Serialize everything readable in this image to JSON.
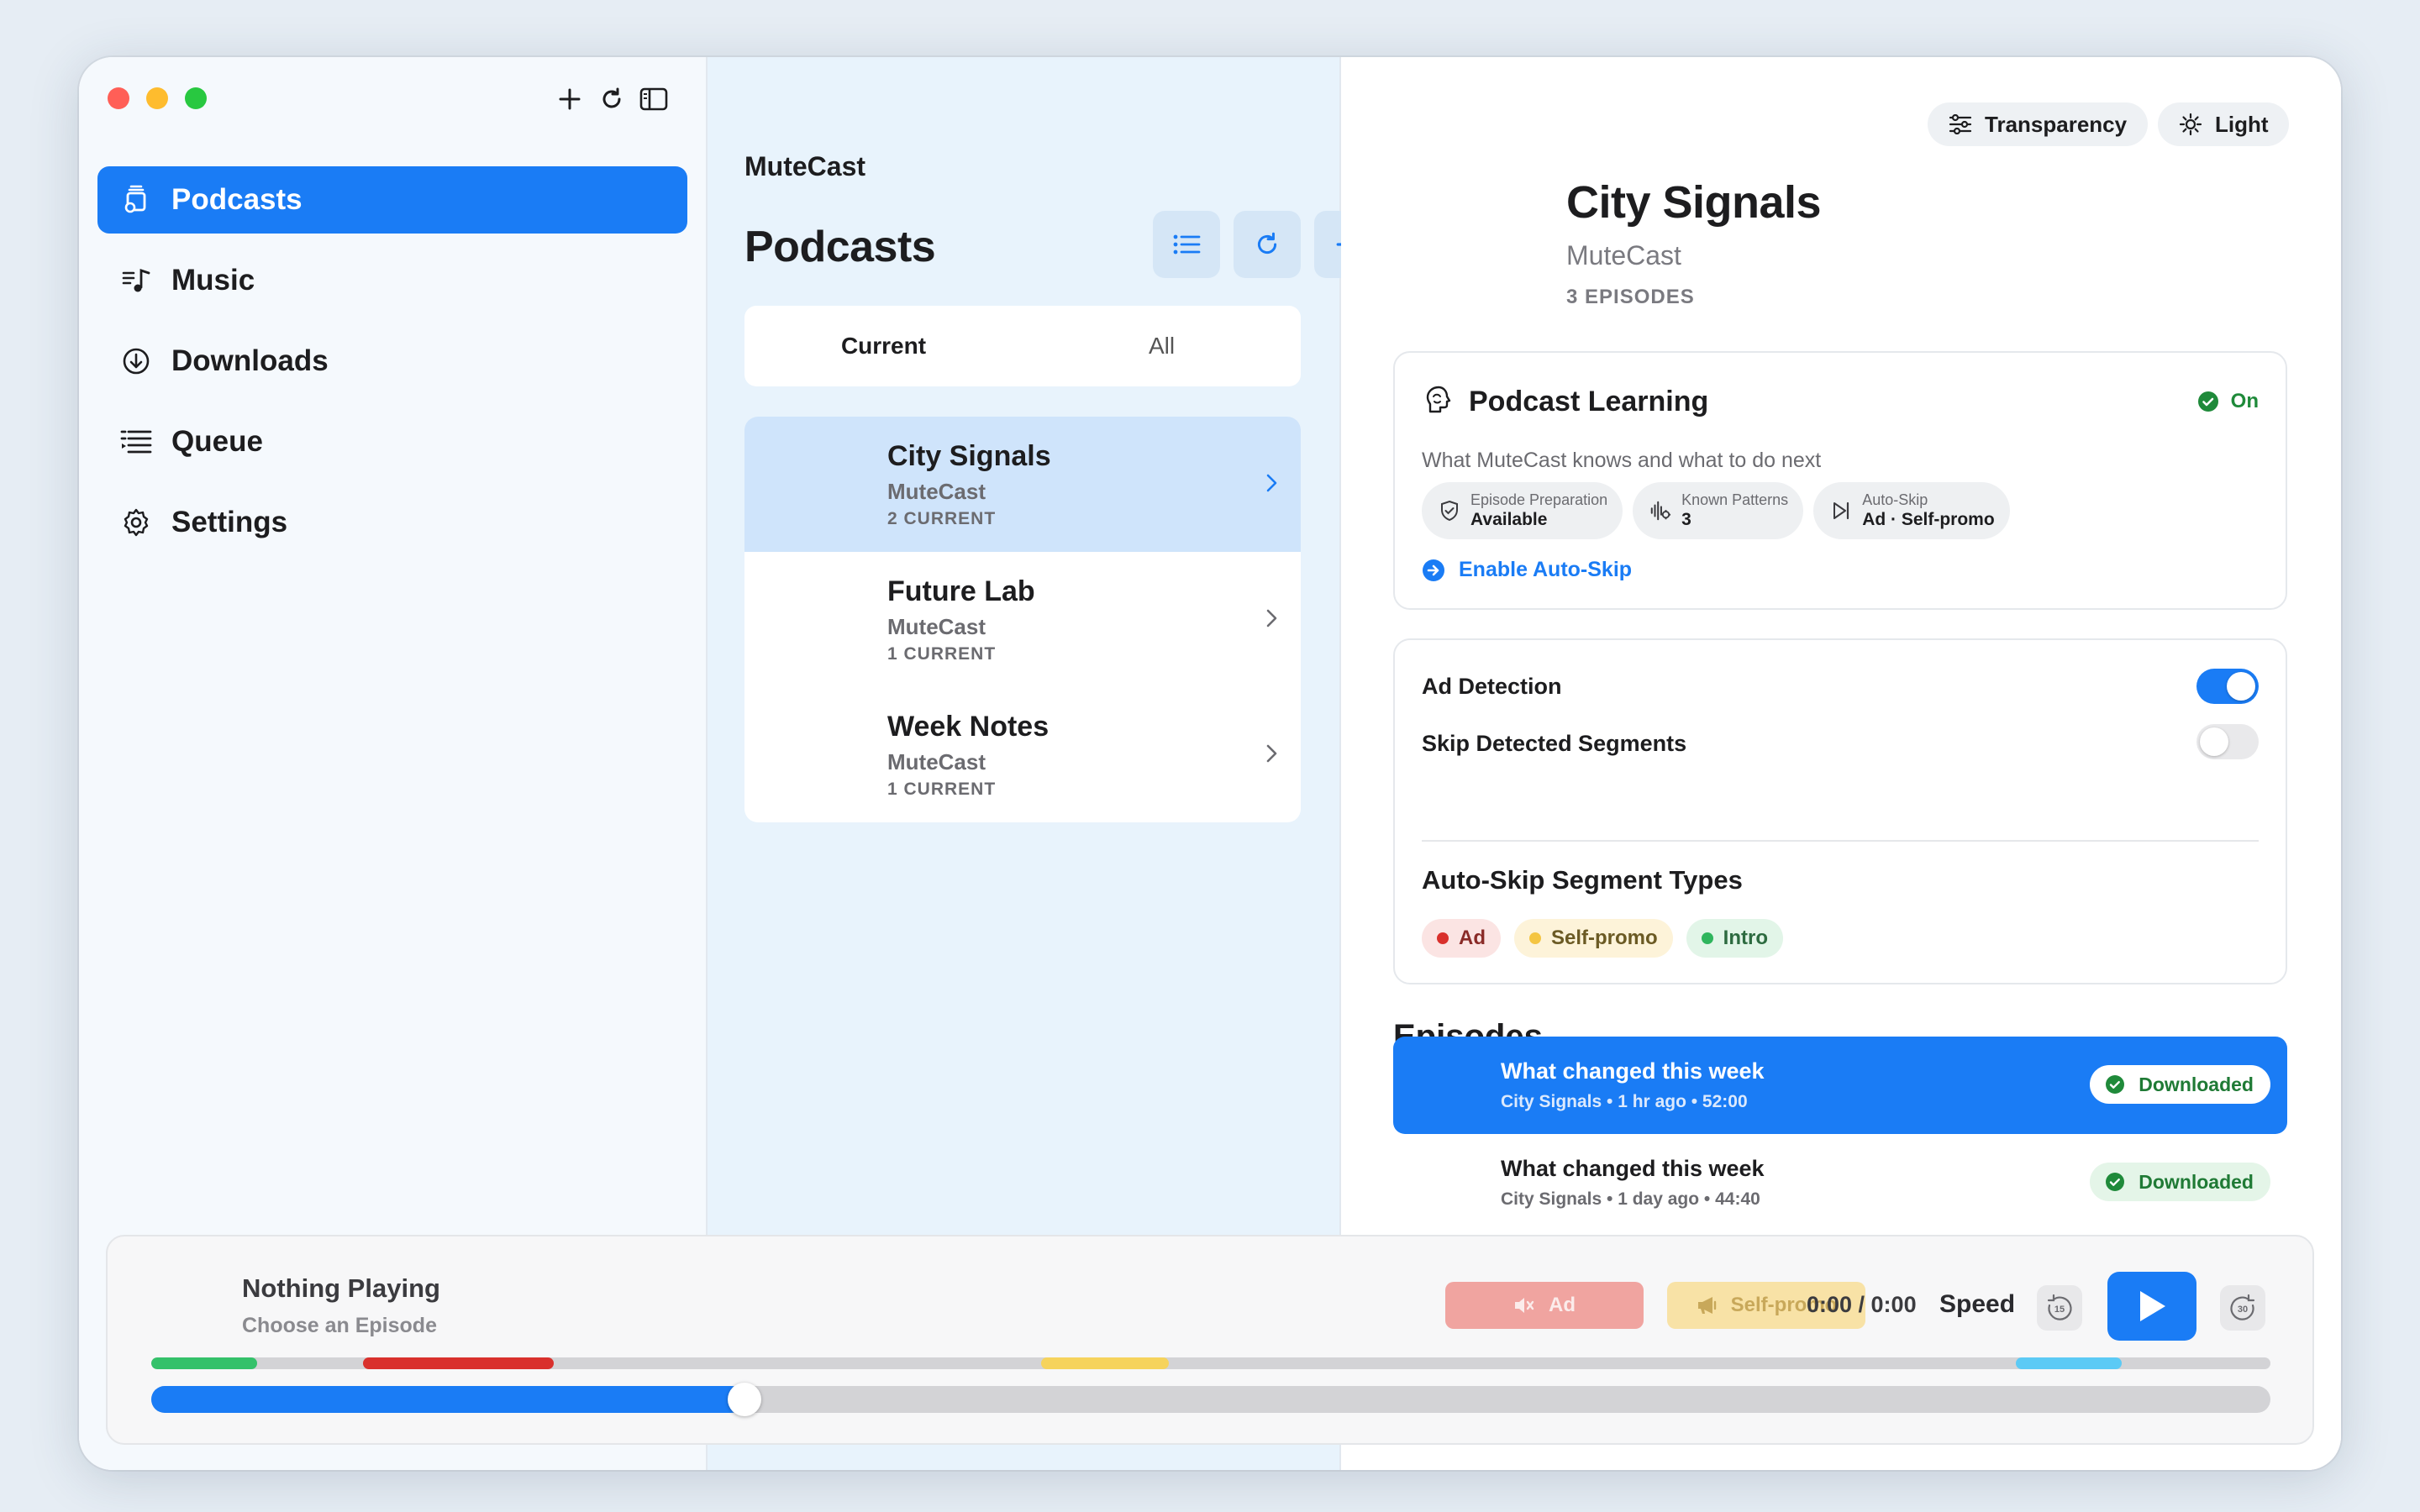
{
  "sidebar": {
    "items": [
      {
        "label": "Podcasts",
        "icon": "podcasts-icon",
        "active": true
      },
      {
        "label": "Music",
        "icon": "music-icon",
        "active": false
      },
      {
        "label": "Downloads",
        "icon": "downloads-icon",
        "active": false
      },
      {
        "label": "Queue",
        "icon": "queue-icon",
        "active": false
      },
      {
        "label": "Settings",
        "icon": "gear-icon",
        "active": false
      }
    ],
    "toolbar_icons": [
      "plus-icon",
      "refresh-icon",
      "sidebar-toggle-icon"
    ]
  },
  "list": {
    "app_name": "MuteCast",
    "title": "Podcasts",
    "tabs": [
      {
        "label": "Current",
        "selected": true
      },
      {
        "label": "All",
        "selected": false
      }
    ],
    "podcasts": [
      {
        "name": "City Signals",
        "author": "MuteCast",
        "count": "2 CURRENT",
        "selected": true
      },
      {
        "name": "Future Lab",
        "author": "MuteCast",
        "count": "1 CURRENT",
        "selected": false
      },
      {
        "name": "Week Notes",
        "author": "MuteCast",
        "count": "1 CURRENT",
        "selected": false
      }
    ]
  },
  "detail": {
    "transparency_label": "Transparency",
    "appearance_label": "Light",
    "title": "City Signals",
    "author": "MuteCast",
    "episode_count": "3 EPISODES",
    "learning": {
      "title": "Podcast Learning",
      "status": "On",
      "subtitle": "What MuteCast knows and what to do next",
      "chips": [
        {
          "label": "Episode Preparation",
          "value": "Available",
          "icon": "shield-check-icon"
        },
        {
          "label": "Known Patterns",
          "value": "3",
          "icon": "waveform-icon"
        },
        {
          "label": "Auto-Skip",
          "value": "Ad · Self-promo",
          "icon": "skip-forward-icon"
        }
      ],
      "action": "Enable Auto-Skip"
    },
    "ad_detection_label": "Ad Detection",
    "ad_detection_on": true,
    "skip_segments_label": "Skip Detected Segments",
    "skip_segments_on": false,
    "segment_types_title": "Auto-Skip Segment Types",
    "segment_types": [
      {
        "label": "Ad",
        "color": "#d9302c",
        "bg": "#fbe4e3"
      },
      {
        "label": "Self-promo",
        "color": "#f4c542",
        "bg": "#fdf3d9"
      },
      {
        "label": "Intro",
        "color": "#2fb55d",
        "bg": "#e2f5e8"
      }
    ],
    "episodes_title": "Episodes",
    "episodes": [
      {
        "title": "What changed this week",
        "meta": "City Signals • 1 hr ago • 52:00",
        "status": "Downloaded",
        "selected": true
      },
      {
        "title": "What changed this week",
        "meta": "City Signals • 1 day ago • 44:40",
        "status": "Downloaded",
        "selected": false
      }
    ]
  },
  "player": {
    "title": "Nothing Playing",
    "subtitle": "Choose an Episode",
    "ad_label": "Ad",
    "selfpromo_label": "Self-promo",
    "time": "0:00 / 0:00",
    "speed_label": "Speed",
    "skip_back_icon": "skip-back-15-icon",
    "skip_forward_icon": "skip-forward-30-icon",
    "progress": 0.28,
    "segments": [
      {
        "type": "intro",
        "start": 0.0,
        "end": 0.05,
        "color": "#34c16a"
      },
      {
        "type": "ad",
        "start": 0.1,
        "end": 0.19,
        "color": "#d9302c"
      },
      {
        "type": "self-promo",
        "start": 0.42,
        "end": 0.48,
        "color": "#f6d35c"
      },
      {
        "type": "outro",
        "start": 0.88,
        "end": 0.93,
        "color": "#5ccaf5"
      }
    ]
  },
  "colors": {
    "accent": "#1a7cf5",
    "sidebar_bg": "#f5f9fd",
    "list_bg": "#e8f3fc",
    "success": "#1f8a3a"
  }
}
